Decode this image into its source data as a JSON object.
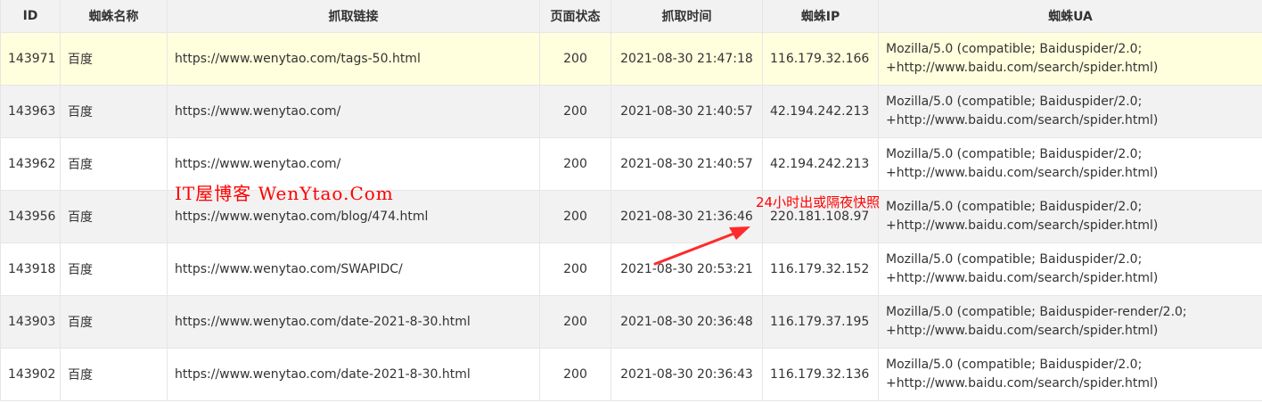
{
  "headers": {
    "id": "ID",
    "name": "蜘蛛名称",
    "url": "抓取链接",
    "status": "页面状态",
    "time": "抓取时间",
    "ip": "蜘蛛IP",
    "ua": "蜘蛛UA"
  },
  "rows": [
    {
      "id": "143971",
      "name": "百度",
      "url": "https://www.wenytao.com/tags-50.html",
      "status": "200",
      "time": "2021-08-30 21:47:18",
      "ip": "116.179.32.166",
      "ua1": "Mozilla/5.0 (compatible; Baiduspider/2.0;",
      "ua2": "+http://www.baidu.com/search/spider.html)"
    },
    {
      "id": "143963",
      "name": "百度",
      "url": "https://www.wenytao.com/",
      "status": "200",
      "time": "2021-08-30 21:40:57",
      "ip": "42.194.242.213",
      "ua1": "Mozilla/5.0 (compatible; Baiduspider/2.0;",
      "ua2": "+http://www.baidu.com/search/spider.html)"
    },
    {
      "id": "143962",
      "name": "百度",
      "url": "https://www.wenytao.com/",
      "status": "200",
      "time": "2021-08-30 21:40:57",
      "ip": "42.194.242.213",
      "ua1": "Mozilla/5.0 (compatible; Baiduspider/2.0;",
      "ua2": "+http://www.baidu.com/search/spider.html)"
    },
    {
      "id": "143956",
      "name": "百度",
      "url": "https://www.wenytao.com/blog/474.html",
      "status": "200",
      "time": "2021-08-30 21:36:46",
      "ip": "220.181.108.97",
      "ua1": "Mozilla/5.0 (compatible; Baiduspider/2.0;",
      "ua2": "+http://www.baidu.com/search/spider.html)"
    },
    {
      "id": "143918",
      "name": "百度",
      "url": "https://www.wenytao.com/SWAPIDC/",
      "status": "200",
      "time": "2021-08-30 20:53:21",
      "ip": "116.179.32.152",
      "ua1": "Mozilla/5.0 (compatible; Baiduspider/2.0;",
      "ua2": "+http://www.baidu.com/search/spider.html)"
    },
    {
      "id": "143903",
      "name": "百度",
      "url": "https://www.wenytao.com/date-2021-8-30.html",
      "status": "200",
      "time": "2021-08-30 20:36:48",
      "ip": "116.179.37.195",
      "ua1": "Mozilla/5.0 (compatible; Baiduspider-render/2.0;",
      "ua2": "+http://www.baidu.com/search/spider.html)"
    },
    {
      "id": "143902",
      "name": "百度",
      "url": "https://www.wenytao.com/date-2021-8-30.html",
      "status": "200",
      "time": "2021-08-30 20:36:43",
      "ip": "116.179.32.136",
      "ua1": "Mozilla/5.0 (compatible; Baiduspider/2.0;",
      "ua2": "+http://www.baidu.com/search/spider.html)"
    }
  ],
  "watermark": "IT屋博客 WenYtao.Com",
  "annotation": "24小时出或隔夜快照",
  "colors": {
    "header_bg": "#f2f2f2",
    "highlight_row": "#ffffdd",
    "stripe_row": "#f2f2f2",
    "annotation_red": "#ff0000"
  }
}
